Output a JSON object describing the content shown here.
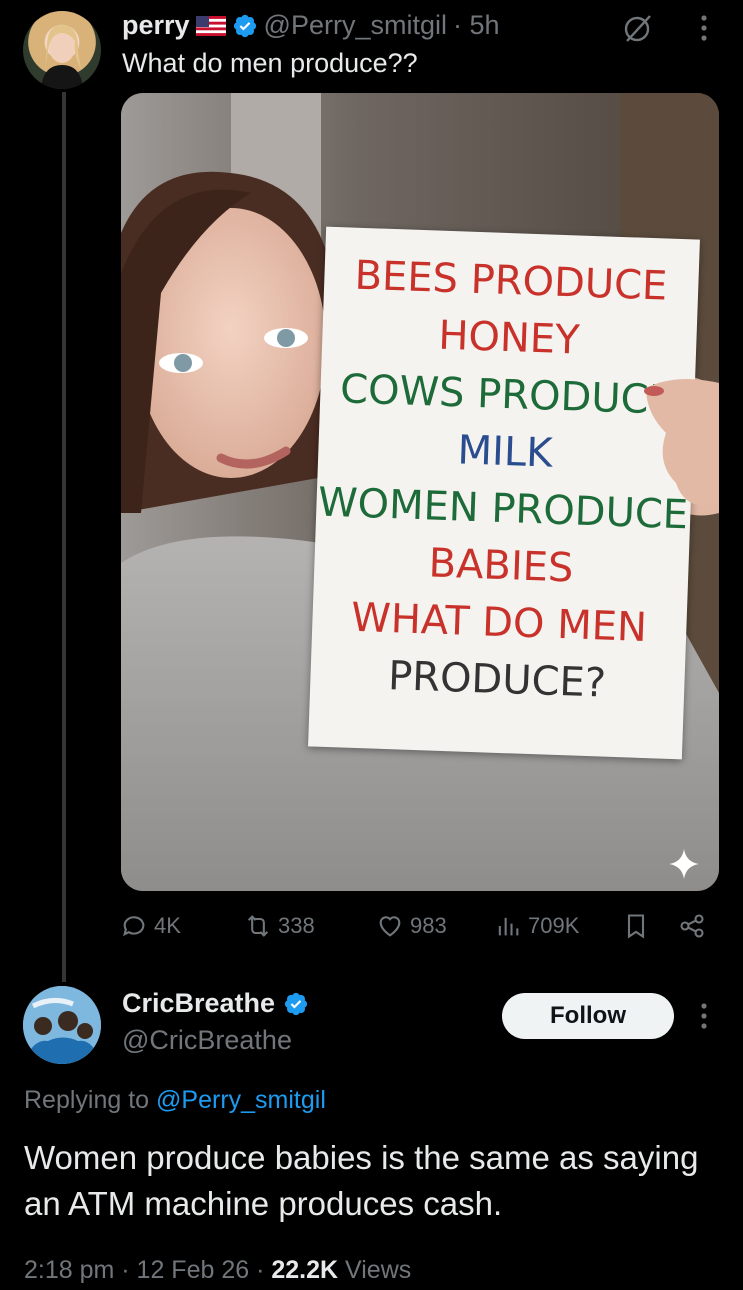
{
  "tweet": {
    "name": "perry",
    "flag": "🇺🇸",
    "handle": "@Perry_smitgil",
    "time": "· 5h",
    "text": "What do men produce??",
    "sign_lines": [
      {
        "text": "BEES PRODUCE",
        "color": "#c8322b"
      },
      {
        "text": "HONEY",
        "color": "#c8322b"
      },
      {
        "text": "COWS PRODUCE",
        "color": "#1e6b3a"
      },
      {
        "text": "MILK",
        "color": "#2a4d8f"
      },
      {
        "text": "WOMEN PRODUCE",
        "color": "#1e6b3a"
      },
      {
        "text": "BABIES",
        "color": "#c8322b"
      },
      {
        "text": "WHAT DO MEN",
        "color": "#c8322b"
      },
      {
        "text": "PRODUCE?",
        "color": "#333333"
      }
    ],
    "stats": {
      "replies": "4K",
      "reposts": "338",
      "likes": "983",
      "views": "709K"
    }
  },
  "reply": {
    "name": "CricBreathe",
    "handle": "@CricBreathe",
    "follow_label": "Follow",
    "replying_prefix": "Replying to",
    "replying_handle": "@Perry_smitgil",
    "text": "Women produce babies is the same as saying an ATM machine produces cash.",
    "time": "2:18 pm · 12 Feb 26 ·",
    "views_count": "22.2K",
    "views_label": "Views"
  },
  "colors": {
    "verified": "#1d9bf0",
    "link": "#1d9bf0",
    "muted": "#71767b"
  }
}
